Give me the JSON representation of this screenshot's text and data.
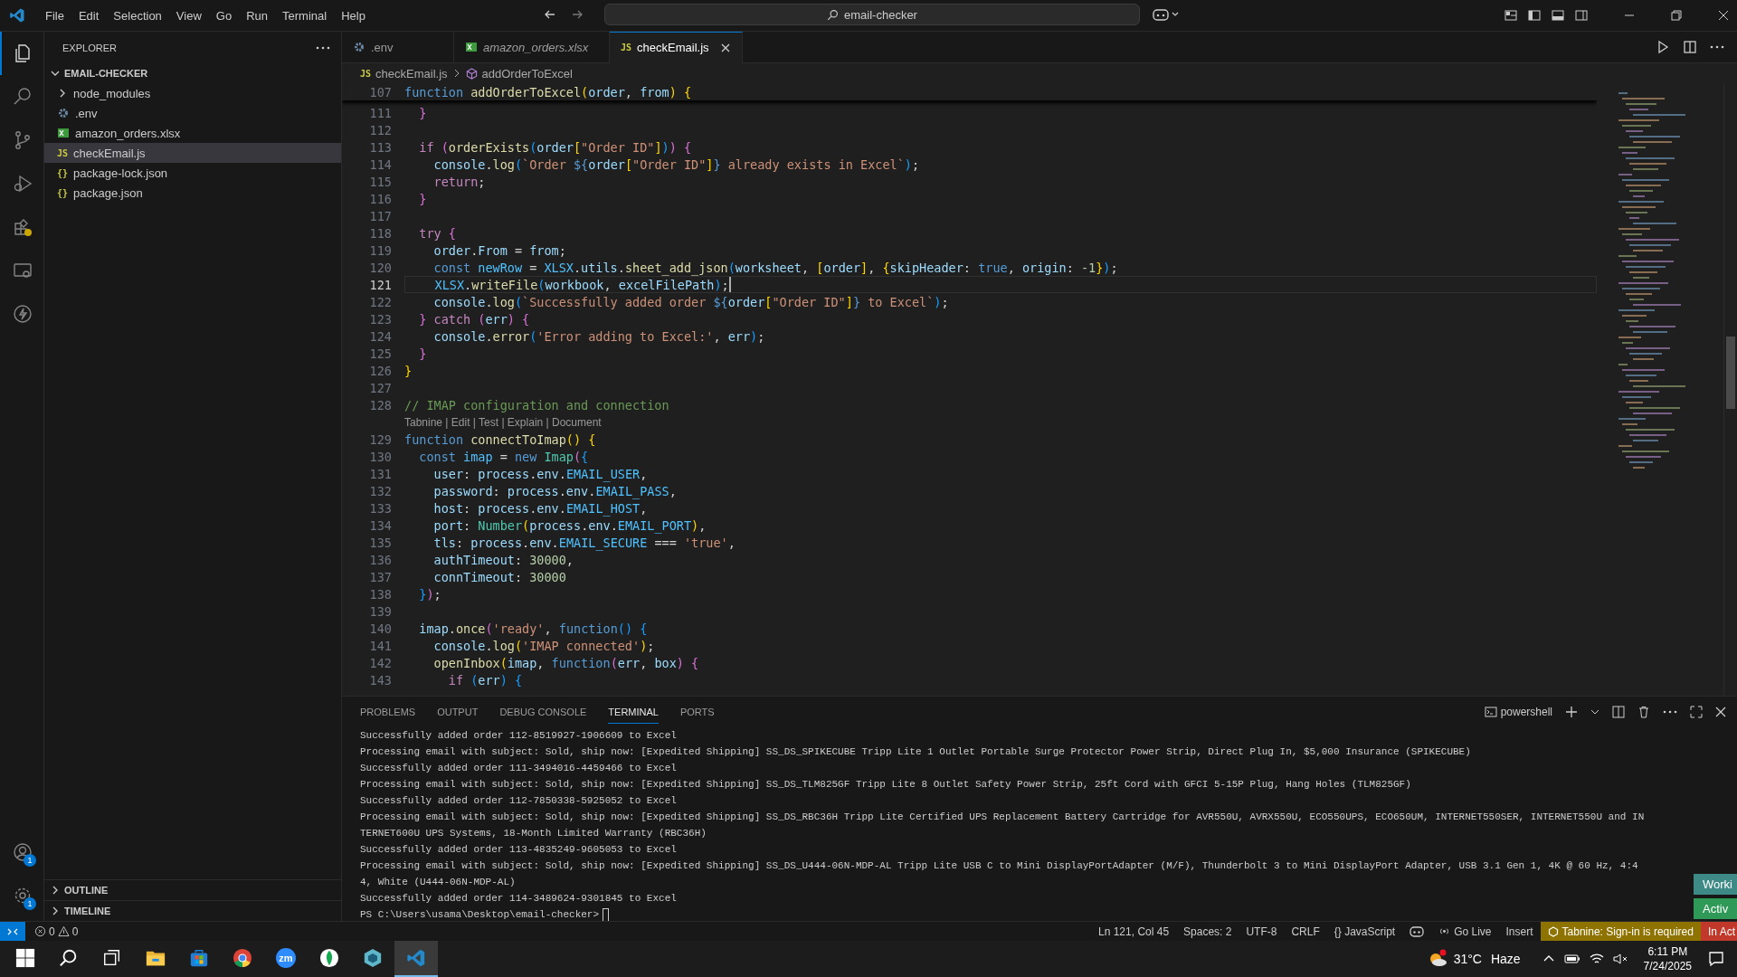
{
  "title_bar": {
    "menu": [
      "File",
      "Edit",
      "Selection",
      "View",
      "Go",
      "Run",
      "Terminal",
      "Help"
    ],
    "command_center": "email-checker"
  },
  "activity_bar": {
    "items": [
      {
        "kind": "explorer",
        "selected": true
      },
      {
        "kind": "search",
        "selected": false
      },
      {
        "kind": "scm",
        "selected": false
      },
      {
        "kind": "debug",
        "selected": false
      },
      {
        "kind": "extensions",
        "selected": false
      },
      {
        "kind": "remote",
        "selected": false
      },
      {
        "kind": "bolt",
        "selected": false
      }
    ],
    "bottom": [
      {
        "kind": "accounts",
        "badge": "1"
      },
      {
        "kind": "manage",
        "badge": "1"
      }
    ]
  },
  "sidebar": {
    "title": "EXPLORER",
    "folder": {
      "name": "EMAIL-CHECKER",
      "expanded": true,
      "children": [
        {
          "name": "node_modules",
          "kind": "folder",
          "expanded": false,
          "selected": false
        },
        {
          "name": ".env",
          "kind": "env",
          "selected": false
        },
        {
          "name": "amazon_orders.xlsx",
          "kind": "sheet",
          "selected": false
        },
        {
          "name": "checkEmail.js",
          "kind": "js",
          "badge": "JS",
          "selected": true
        },
        {
          "name": "package-lock.json",
          "kind": "json",
          "badge": "{}",
          "selected": false
        },
        {
          "name": "package.json",
          "kind": "json",
          "badge": "{}",
          "selected": false
        }
      ]
    },
    "sections": [
      {
        "name": "OUTLINE",
        "expanded": false
      },
      {
        "name": "TIMELINE",
        "expanded": false
      }
    ]
  },
  "tabs": [
    {
      "label": ".env",
      "kind": "env",
      "preview": false,
      "selected": false
    },
    {
      "label": "amazon_orders.xlsx",
      "kind": "sheet",
      "preview": true,
      "selected": false
    },
    {
      "label": "checkEmail.js",
      "kind": "js",
      "badge": "JS",
      "preview": false,
      "selected": true
    }
  ],
  "breadcrumb": {
    "badge": "JS",
    "file": "checkEmail.js",
    "symbol": "addOrderToExcel"
  },
  "editor": {
    "sticky": {
      "num": "107",
      "tokens": [
        {
          "text": "function ",
          "kind": "keyword"
        },
        {
          "text": "addOrderToExcel",
          "kind": "function"
        },
        {
          "text": "(",
          "kind": "bracket1"
        },
        {
          "text": "order",
          "kind": "variable"
        },
        {
          "text": ", ",
          "kind": "plain"
        },
        {
          "text": "from",
          "kind": "variable"
        },
        {
          "text": ") {",
          "kind": "bracket1"
        }
      ]
    },
    "lines": [
      {
        "num": "111",
        "current": false,
        "tokens": [
          {
            "text": "  }",
            "kind": "bracket2"
          }
        ]
      },
      {
        "num": "112",
        "current": false
      },
      {
        "num": "113",
        "current": false,
        "tokens": [
          {
            "text": "  if ",
            "kind": "control"
          },
          {
            "text": "(",
            "kind": "bracket2"
          },
          {
            "text": "orderExists",
            "kind": "function"
          },
          {
            "text": "(",
            "kind": "bracket3"
          },
          {
            "text": "order",
            "kind": "variable"
          },
          {
            "text": "[",
            "kind": "bracket1"
          },
          {
            "text": "\"Order ID\"",
            "kind": "string"
          },
          {
            "text": "]",
            "kind": "bracket1"
          },
          {
            "text": ")",
            "kind": "bracket3"
          },
          {
            "text": ") {",
            "kind": "bracket2"
          }
        ]
      },
      {
        "num": "114",
        "current": false,
        "tokens": [
          {
            "text": "    console",
            "kind": "variable"
          },
          {
            "text": ".",
            "kind": "plain"
          },
          {
            "text": "log",
            "kind": "function"
          },
          {
            "text": "(",
            "kind": "bracket3"
          },
          {
            "text": "`Order ",
            "kind": "string"
          },
          {
            "text": "${",
            "kind": "keyword"
          },
          {
            "text": "order",
            "kind": "variable"
          },
          {
            "text": "[",
            "kind": "bracket1"
          },
          {
            "text": "\"Order ID\"",
            "kind": "string"
          },
          {
            "text": "]",
            "kind": "bracket1"
          },
          {
            "text": "}",
            "kind": "keyword"
          },
          {
            "text": " already exists in Excel`",
            "kind": "string"
          },
          {
            "text": ")",
            "kind": "bracket3"
          },
          {
            "text": ";",
            "kind": "plain"
          }
        ]
      },
      {
        "num": "115",
        "current": false,
        "tokens": [
          {
            "text": "    return",
            "kind": "control"
          },
          {
            "text": ";",
            "kind": "plain"
          }
        ]
      },
      {
        "num": "116",
        "current": false,
        "tokens": [
          {
            "text": "  }",
            "kind": "bracket2"
          }
        ]
      },
      {
        "num": "117",
        "current": false
      },
      {
        "num": "118",
        "current": false,
        "tokens": [
          {
            "text": "  try ",
            "kind": "control"
          },
          {
            "text": "{",
            "kind": "bracket2"
          }
        ]
      },
      {
        "num": "119",
        "current": false,
        "tokens": [
          {
            "text": "    order",
            "kind": "variable"
          },
          {
            "text": ".",
            "kind": "plain"
          },
          {
            "text": "From",
            "kind": "variable"
          },
          {
            "text": " = ",
            "kind": "plain"
          },
          {
            "text": "from",
            "kind": "variable"
          },
          {
            "text": ";",
            "kind": "plain"
          }
        ]
      },
      {
        "num": "120",
        "current": false,
        "tokens": [
          {
            "text": "    const ",
            "kind": "keyword"
          },
          {
            "text": "newRow",
            "kind": "constant"
          },
          {
            "text": " = ",
            "kind": "plain"
          },
          {
            "text": "XLSX",
            "kind": "constant"
          },
          {
            "text": ".",
            "kind": "plain"
          },
          {
            "text": "utils",
            "kind": "variable"
          },
          {
            "text": ".",
            "kind": "plain"
          },
          {
            "text": "sheet_add_json",
            "kind": "function"
          },
          {
            "text": "(",
            "kind": "bracket3"
          },
          {
            "text": "worksheet",
            "kind": "variable"
          },
          {
            "text": ", ",
            "kind": "plain"
          },
          {
            "text": "[",
            "kind": "bracket1"
          },
          {
            "text": "order",
            "kind": "variable"
          },
          {
            "text": "]",
            "kind": "bracket1"
          },
          {
            "text": ", ",
            "kind": "plain"
          },
          {
            "text": "{",
            "kind": "bracket1"
          },
          {
            "text": "skipHeader",
            "kind": "variable"
          },
          {
            "text": ": ",
            "kind": "plain"
          },
          {
            "text": "true",
            "kind": "keyword"
          },
          {
            "text": ", ",
            "kind": "plain"
          },
          {
            "text": "origin",
            "kind": "variable"
          },
          {
            "text": ": ",
            "kind": "plain"
          },
          {
            "text": "-1",
            "kind": "number"
          },
          {
            "text": "}",
            "kind": "bracket1"
          },
          {
            "text": ")",
            "kind": "bracket3"
          },
          {
            "text": ";",
            "kind": "plain"
          }
        ]
      },
      {
        "num": "121",
        "current": true,
        "tokens": [
          {
            "text": "    XLSX",
            "kind": "constant"
          },
          {
            "text": ".",
            "kind": "plain"
          },
          {
            "text": "writeFile",
            "kind": "function"
          },
          {
            "text": "(",
            "kind": "bracket3"
          },
          {
            "text": "workbook",
            "kind": "variable"
          },
          {
            "text": ", ",
            "kind": "plain"
          },
          {
            "text": "excelFilePath",
            "kind": "variable"
          },
          {
            "text": ")",
            "kind": "bracket3"
          },
          {
            "text": ";",
            "kind": "plain"
          }
        ]
      },
      {
        "num": "122",
        "current": false,
        "tokens": [
          {
            "text": "    console",
            "kind": "variable"
          },
          {
            "text": ".",
            "kind": "plain"
          },
          {
            "text": "log",
            "kind": "function"
          },
          {
            "text": "(",
            "kind": "bracket3"
          },
          {
            "text": "`Successfully added order ",
            "kind": "string"
          },
          {
            "text": "${",
            "kind": "keyword"
          },
          {
            "text": "order",
            "kind": "variable"
          },
          {
            "text": "[",
            "kind": "bracket1"
          },
          {
            "text": "\"Order ID\"",
            "kind": "string"
          },
          {
            "text": "]",
            "kind": "bracket1"
          },
          {
            "text": "}",
            "kind": "keyword"
          },
          {
            "text": " to Excel`",
            "kind": "string"
          },
          {
            "text": ")",
            "kind": "bracket3"
          },
          {
            "text": ";",
            "kind": "plain"
          }
        ]
      },
      {
        "num": "123",
        "current": false,
        "tokens": [
          {
            "text": "  } ",
            "kind": "bracket2"
          },
          {
            "text": "catch ",
            "kind": "control"
          },
          {
            "text": "(",
            "kind": "bracket2"
          },
          {
            "text": "err",
            "kind": "variable"
          },
          {
            "text": ") {",
            "kind": "bracket2"
          }
        ]
      },
      {
        "num": "124",
        "current": false,
        "tokens": [
          {
            "text": "    console",
            "kind": "variable"
          },
          {
            "text": ".",
            "kind": "plain"
          },
          {
            "text": "error",
            "kind": "function"
          },
          {
            "text": "(",
            "kind": "bracket3"
          },
          {
            "text": "'Error adding to Excel:'",
            "kind": "string"
          },
          {
            "text": ", ",
            "kind": "plain"
          },
          {
            "text": "err",
            "kind": "variable"
          },
          {
            "text": ")",
            "kind": "bracket3"
          },
          {
            "text": ";",
            "kind": "plain"
          }
        ]
      },
      {
        "num": "125",
        "current": false,
        "tokens": [
          {
            "text": "  }",
            "kind": "bracket2"
          }
        ]
      },
      {
        "num": "126",
        "current": false,
        "tokens": [
          {
            "text": "}",
            "kind": "bracket1"
          }
        ]
      },
      {
        "num": "127",
        "current": false
      },
      {
        "num": "128",
        "current": false,
        "tokens": [
          {
            "text": "// IMAP configuration and connection",
            "kind": "comment"
          }
        ],
        "codelens": "Tabnine | Edit | Test | Explain | Document"
      },
      {
        "num": "129",
        "current": false,
        "tokens": [
          {
            "text": "function ",
            "kind": "keyword"
          },
          {
            "text": "connectToImap",
            "kind": "function"
          },
          {
            "text": "() {",
            "kind": "bracket1"
          }
        ]
      },
      {
        "num": "130",
        "current": false,
        "tokens": [
          {
            "text": "  const ",
            "kind": "keyword"
          },
          {
            "text": "imap",
            "kind": "constant"
          },
          {
            "text": " = ",
            "kind": "plain"
          },
          {
            "text": "new ",
            "kind": "keyword"
          },
          {
            "text": "Imap",
            "kind": "type"
          },
          {
            "text": "(",
            "kind": "bracket2"
          },
          {
            "text": "{",
            "kind": "bracket3"
          }
        ]
      },
      {
        "num": "131",
        "current": false,
        "tokens": [
          {
            "text": "    user",
            "kind": "variable"
          },
          {
            "text": ": ",
            "kind": "plain"
          },
          {
            "text": "process",
            "kind": "variable"
          },
          {
            "text": ".",
            "kind": "plain"
          },
          {
            "text": "env",
            "kind": "variable"
          },
          {
            "text": ".",
            "kind": "plain"
          },
          {
            "text": "EMAIL_USER",
            "kind": "constant"
          },
          {
            "text": ",",
            "kind": "plain"
          }
        ]
      },
      {
        "num": "132",
        "current": false,
        "tokens": [
          {
            "text": "    password",
            "kind": "variable"
          },
          {
            "text": ": ",
            "kind": "plain"
          },
          {
            "text": "process",
            "kind": "variable"
          },
          {
            "text": ".",
            "kind": "plain"
          },
          {
            "text": "env",
            "kind": "variable"
          },
          {
            "text": ".",
            "kind": "plain"
          },
          {
            "text": "EMAIL_PASS",
            "kind": "constant"
          },
          {
            "text": ",",
            "kind": "plain"
          }
        ]
      },
      {
        "num": "133",
        "current": false,
        "tokens": [
          {
            "text": "    host",
            "kind": "variable"
          },
          {
            "text": ": ",
            "kind": "plain"
          },
          {
            "text": "process",
            "kind": "variable"
          },
          {
            "text": ".",
            "kind": "plain"
          },
          {
            "text": "env",
            "kind": "variable"
          },
          {
            "text": ".",
            "kind": "plain"
          },
          {
            "text": "EMAIL_HOST",
            "kind": "constant"
          },
          {
            "text": ",",
            "kind": "plain"
          }
        ]
      },
      {
        "num": "134",
        "current": false,
        "tokens": [
          {
            "text": "    port",
            "kind": "variable"
          },
          {
            "text": ": ",
            "kind": "plain"
          },
          {
            "text": "Number",
            "kind": "type"
          },
          {
            "text": "(",
            "kind": "bracket1"
          },
          {
            "text": "process",
            "kind": "variable"
          },
          {
            "text": ".",
            "kind": "plain"
          },
          {
            "text": "env",
            "kind": "variable"
          },
          {
            "text": ".",
            "kind": "plain"
          },
          {
            "text": "EMAIL_PORT",
            "kind": "constant"
          },
          {
            "text": ")",
            "kind": "bracket1"
          },
          {
            "text": ",",
            "kind": "plain"
          }
        ]
      },
      {
        "num": "135",
        "current": false,
        "tokens": [
          {
            "text": "    tls",
            "kind": "variable"
          },
          {
            "text": ": ",
            "kind": "plain"
          },
          {
            "text": "process",
            "kind": "variable"
          },
          {
            "text": ".",
            "kind": "plain"
          },
          {
            "text": "env",
            "kind": "variable"
          },
          {
            "text": ".",
            "kind": "plain"
          },
          {
            "text": "EMAIL_SECURE",
            "kind": "constant"
          },
          {
            "text": " === ",
            "kind": "plain"
          },
          {
            "text": "'true'",
            "kind": "string"
          },
          {
            "text": ",",
            "kind": "plain"
          }
        ]
      },
      {
        "num": "136",
        "current": false,
        "tokens": [
          {
            "text": "    authTimeout",
            "kind": "variable"
          },
          {
            "text": ": ",
            "kind": "plain"
          },
          {
            "text": "30000",
            "kind": "number"
          },
          {
            "text": ",",
            "kind": "plain"
          }
        ]
      },
      {
        "num": "137",
        "current": false,
        "tokens": [
          {
            "text": "    connTimeout",
            "kind": "variable"
          },
          {
            "text": ": ",
            "kind": "plain"
          },
          {
            "text": "30000",
            "kind": "number"
          }
        ]
      },
      {
        "num": "138",
        "current": false,
        "tokens": [
          {
            "text": "  }",
            "kind": "bracket3"
          },
          {
            "text": ")",
            "kind": "bracket2"
          },
          {
            "text": ";",
            "kind": "plain"
          }
        ]
      },
      {
        "num": "139",
        "current": false
      },
      {
        "num": "140",
        "current": false,
        "tokens": [
          {
            "text": "  imap",
            "kind": "variable"
          },
          {
            "text": ".",
            "kind": "plain"
          },
          {
            "text": "once",
            "kind": "function"
          },
          {
            "text": "(",
            "kind": "bracket2"
          },
          {
            "text": "'ready'",
            "kind": "string"
          },
          {
            "text": ", ",
            "kind": "plain"
          },
          {
            "text": "function",
            "kind": "keyword"
          },
          {
            "text": "() {",
            "kind": "bracket3"
          }
        ]
      },
      {
        "num": "141",
        "current": false,
        "tokens": [
          {
            "text": "    console",
            "kind": "variable"
          },
          {
            "text": ".",
            "kind": "plain"
          },
          {
            "text": "log",
            "kind": "function"
          },
          {
            "text": "(",
            "kind": "bracket1"
          },
          {
            "text": "'IMAP connected'",
            "kind": "string"
          },
          {
            "text": ")",
            "kind": "bracket1"
          },
          {
            "text": ";",
            "kind": "plain"
          }
        ]
      },
      {
        "num": "142",
        "current": false,
        "tokens": [
          {
            "text": "    openInbox",
            "kind": "function"
          },
          {
            "text": "(",
            "kind": "bracket1"
          },
          {
            "text": "imap",
            "kind": "variable"
          },
          {
            "text": ", ",
            "kind": "plain"
          },
          {
            "text": "function",
            "kind": "keyword"
          },
          {
            "text": "(",
            "kind": "bracket2"
          },
          {
            "text": "err",
            "kind": "variable"
          },
          {
            "text": ", ",
            "kind": "plain"
          },
          {
            "text": "box",
            "kind": "variable"
          },
          {
            "text": ") {",
            "kind": "bracket2"
          }
        ]
      },
      {
        "num": "143",
        "current": false,
        "tokens": [
          {
            "text": "      if ",
            "kind": "control"
          },
          {
            "text": "(",
            "kind": "bracket3"
          },
          {
            "text": "err",
            "kind": "variable"
          },
          {
            "text": ") {",
            "kind": "bracket3"
          }
        ]
      }
    ]
  },
  "panel": {
    "tabs": [
      {
        "label": "PROBLEMS",
        "selected": false
      },
      {
        "label": "OUTPUT",
        "selected": false
      },
      {
        "label": "DEBUG CONSOLE",
        "selected": false
      },
      {
        "label": "TERMINAL",
        "selected": true
      },
      {
        "label": "PORTS",
        "selected": false
      }
    ],
    "shell": "powershell",
    "terminal_lines": [
      "Successfully added order 112-8519927-1906609 to Excel",
      "Processing email with subject: Sold, ship now: [Expedited Shipping] SS_DS_SPIKECUBE Tripp Lite 1 Outlet Portable Surge Protector Power Strip, Direct Plug In, $5,000 Insurance (SPIKECUBE)",
      "Successfully added order 111-3494016-4459466 to Excel",
      "Processing email with subject: Sold, ship now: [Expedited Shipping] SS_DS_TLM825GF Tripp Lite 8 Outlet Safety Power Strip, 25ft Cord with GFCI 5-15P Plug, Hang Holes (TLM825GF)",
      "Successfully added order 112-7850338-5925052 to Excel",
      "Processing email with subject: Sold, ship now: [Expedited Shipping] SS_DS_RBC36H Tripp Lite Certified UPS Replacement Battery Cartridge for AVR550U, AVRX550U, ECO550UPS, ECO650UM, INTERNET550SER, INTERNET550U and IN",
      "TERNET600U UPS Systems, 18-Month Limited Warranty (RBC36H)",
      "Successfully added order 113-4835249-9605053 to Excel",
      "Processing email with subject: Sold, ship now: [Expedited Shipping] SS_DS_U444-06N-MDP-AL Tripp Lite USB C to Mini DisplayPortAdapter (M/F), Thunderbolt 3 to Mini DisplayPort Adapter, USB 3.1 Gen 1, 4K @ 60 Hz, 4:4",
      "4, White (U444-06N-MDP-AL)",
      "Successfully added order 114-3489624-9301845 to Excel"
    ],
    "prompt": "PS C:\\Users\\usama\\Desktop\\email-checker>"
  },
  "notifications": [
    {
      "text": "Worki",
      "color": "#3e8a86"
    },
    {
      "text": "Activ",
      "color": "#2f9a57"
    }
  ],
  "status_bar": {
    "errors": "0",
    "warnings": "0",
    "items": [
      "Ln 121, Col 45",
      "Spaces: 2",
      "UTF-8",
      "CRLF"
    ],
    "language_badge": "{}",
    "language": "JavaScript",
    "go_live": "Go Live",
    "mode": "Insert",
    "tabnine": "Tabnine: Sign-in is required",
    "cut_notice": "In Act"
  },
  "taskbar": {
    "apps": [
      {
        "kind": "start",
        "active": false
      },
      {
        "kind": "search",
        "active": false
      },
      {
        "kind": "taskview",
        "active": false
      },
      {
        "kind": "files",
        "active": false
      },
      {
        "kind": "store",
        "active": false
      },
      {
        "kind": "chrome",
        "active": false
      },
      {
        "kind": "zoom",
        "label": "zm",
        "active": false
      },
      {
        "kind": "leaf",
        "active": false
      },
      {
        "kind": "hex",
        "active": false
      },
      {
        "kind": "vscode",
        "active": true
      }
    ],
    "weather": {
      "temp": "31°C",
      "condition": "Haze"
    },
    "time": "6:11 PM",
    "date": "7/24/2025"
  }
}
